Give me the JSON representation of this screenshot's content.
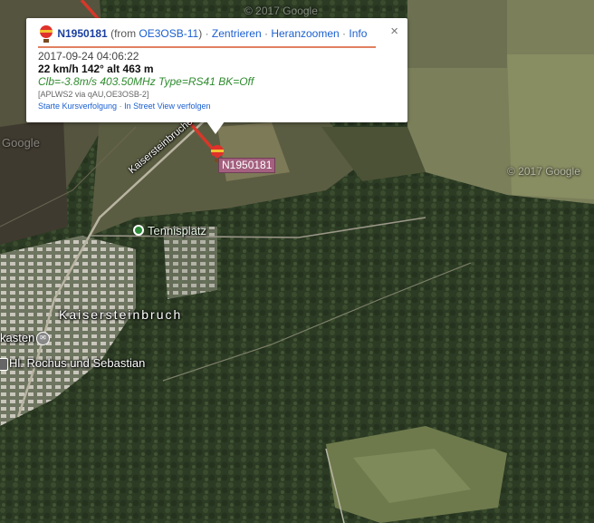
{
  "popup": {
    "callsign": "N1950181",
    "from_text": "(from",
    "from_station": "OE3OSB-11",
    "from_close": ")",
    "links": [
      "Zentrieren",
      "Heranzoomen",
      "Info"
    ],
    "separator": "·",
    "timestamp": "2017-09-24 04:06:22",
    "speed_line": "22 km/h 142° alt 463 m",
    "comment": "Clb=-3.8m/s 403.50MHz Type=RS41 BK=Off",
    "path": "[APLWS2 via qAU,OE3OSB-2]",
    "bottom_links": [
      "Starte Kursverfolgung",
      "In Street View verfolgen"
    ],
    "close_glyph": "×"
  },
  "map": {
    "marker_label": "N1950181",
    "places": {
      "road": "Kaisersteinbrucher",
      "tennis": "Tennisplatz",
      "village": "Kaisersteinbruch",
      "kasten": "kasten",
      "church": "Hl. Rochus und Sebastian"
    },
    "watermarks": [
      "© 2017 Google",
      "Google",
      "© 2017 Google"
    ]
  }
}
